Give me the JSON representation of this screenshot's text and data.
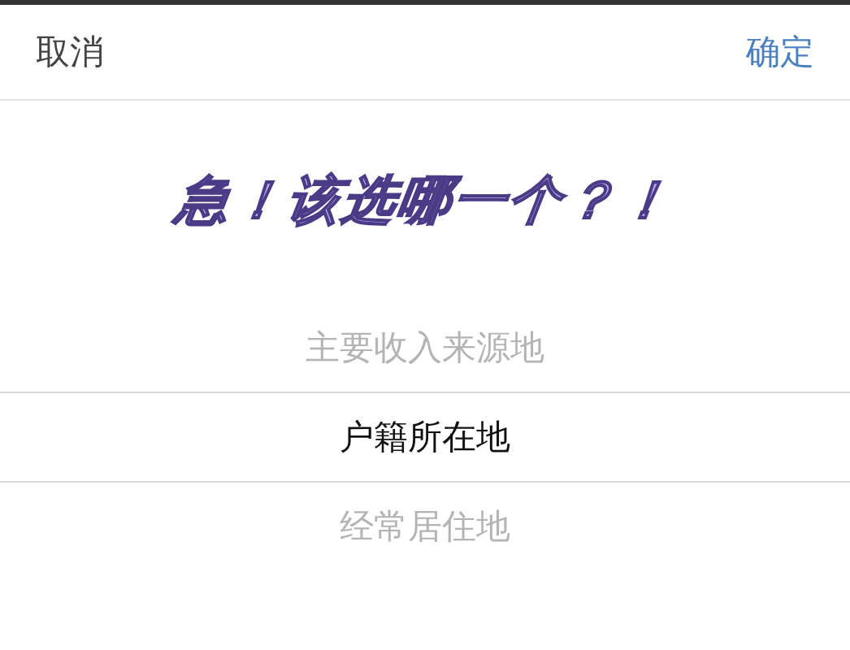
{
  "toolbar": {
    "cancel": "取消",
    "confirm": "确定"
  },
  "headline": "急！该选哪一个？！",
  "picker": {
    "options": [
      {
        "label": "主要收入来源地",
        "selected": false
      },
      {
        "label": "户籍所在地",
        "selected": true
      },
      {
        "label": "经常居住地",
        "selected": false
      }
    ]
  }
}
